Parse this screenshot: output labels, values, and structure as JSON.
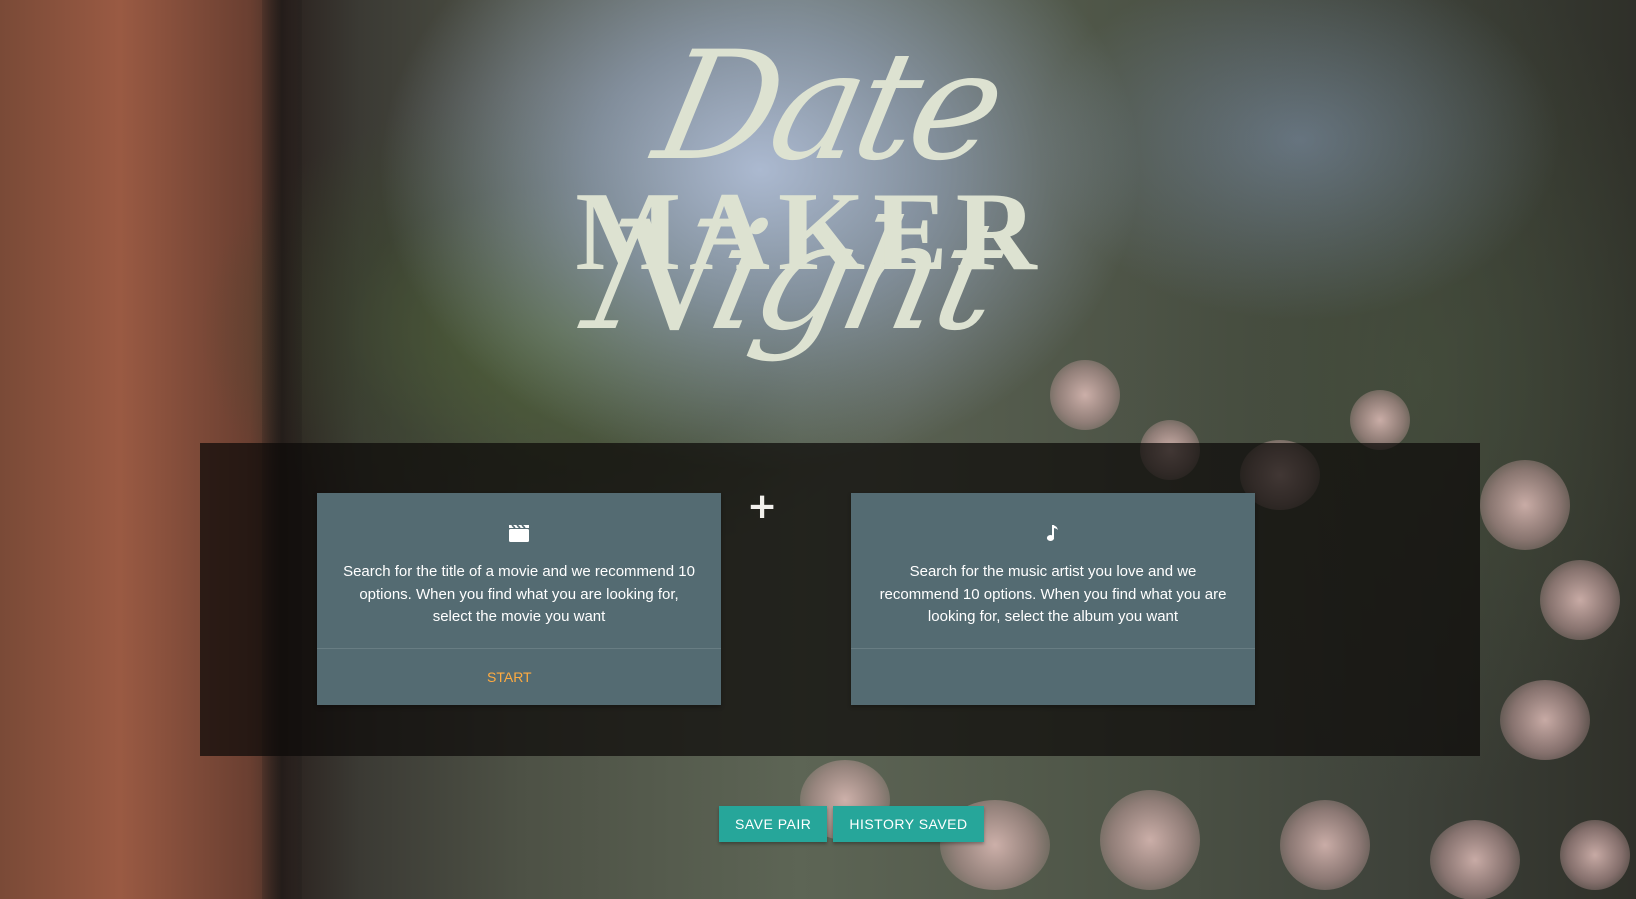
{
  "logo": {
    "script_text": "Date Night",
    "maker_text": "MAKER",
    "color": "#dde2d1"
  },
  "cards": {
    "movie": {
      "icon": "clapperboard-icon",
      "description": "Search for the title of a movie and we recommend 10 options. When you find what you are looking for, select the movie you want",
      "action_label": "START"
    },
    "music": {
      "icon": "music-note-icon",
      "description": "Search for the music artist you love and we recommend 10 options. When you find what you are looking for, select the album you want"
    }
  },
  "plus_sign": "+",
  "buttons": {
    "save_pair": "SAVE PAIR",
    "history_saved": "HISTORY SAVED"
  },
  "colors": {
    "card_bg": "#546b72",
    "accent_link": "#ffab40",
    "button_bg": "#26a69a"
  }
}
